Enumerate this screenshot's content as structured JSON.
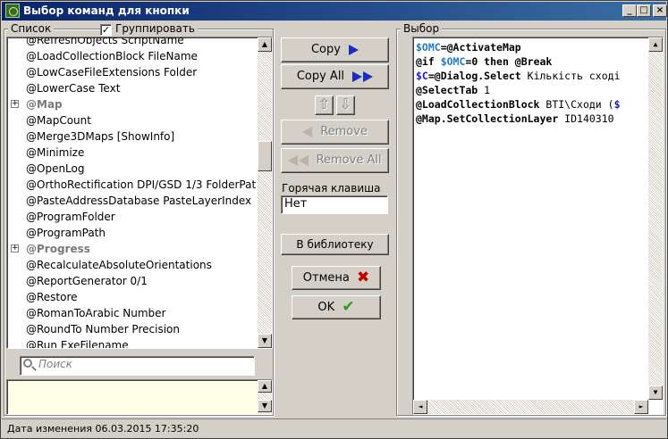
{
  "window": {
    "title": "Выбор команд для кнопки",
    "controls": {
      "minimize": "_",
      "maximize": "□",
      "close": "×"
    }
  },
  "list_panel": {
    "label": "Список",
    "group_checkbox_label": "Группировать",
    "group_checked": true,
    "items": [
      {
        "text": "@LoadCollectionBlock FileName",
        "type": "item"
      },
      {
        "text": "@LowCaseFileExtensions Folder",
        "type": "item"
      },
      {
        "text": "@LowerCase Text",
        "type": "item"
      },
      {
        "text": "@Map",
        "type": "group"
      },
      {
        "text": "@MapCount",
        "type": "item"
      },
      {
        "text": "@Merge3DMaps [ShowInfo]",
        "type": "item"
      },
      {
        "text": "@Minimize",
        "type": "item"
      },
      {
        "text": "@OpenLog",
        "type": "item"
      },
      {
        "text": "@OrthoRectification DPI/GSD 1/3 FolderPat",
        "type": "item"
      },
      {
        "text": "@PasteAddressDatabase PasteLayerIndex",
        "type": "item"
      },
      {
        "text": "@ProgramFolder",
        "type": "item"
      },
      {
        "text": "@ProgramPath",
        "type": "item"
      },
      {
        "text": "@Progress",
        "type": "group"
      },
      {
        "text": "@RecalculateAbsoluteOrientations",
        "type": "item"
      },
      {
        "text": "@ReportGenerator 0/1",
        "type": "item"
      },
      {
        "text": "@Restore",
        "type": "item"
      },
      {
        "text": "@RomanToArabic Number",
        "type": "item"
      },
      {
        "text": "@RoundTo Number Precision",
        "type": "item"
      },
      {
        "text": "@Run ExeFilename",
        "type": "item"
      }
    ],
    "partial_top_item": "@RefreshObjects ScriptName",
    "search_placeholder": "Поиск"
  },
  "middle": {
    "copy_label": "Copy",
    "copy_all_label": "Copy All",
    "remove_label": "Remove",
    "remove_all_label": "Remove All",
    "hotkey_label": "Горячая клавиша",
    "hotkey_value": "Нет",
    "library_label": "В библиотеку",
    "cancel_label": "Отмена",
    "ok_label": "OK",
    "up_arrow": "⇧",
    "down_arrow": "⇩"
  },
  "selection_panel": {
    "label": "Выбор",
    "lines": [
      [
        {
          "t": "$OMC",
          "c": "var"
        },
        {
          "t": "=@ActivateMap",
          "c": "kw"
        }
      ],
      [
        {
          "t": "@if ",
          "c": "kw"
        },
        {
          "t": "$OMC",
          "c": "var"
        },
        {
          "t": "=0 then @Break",
          "c": "kw"
        }
      ],
      [
        {
          "t": "$C",
          "c": "bl"
        },
        {
          "t": "=@Dialog.Select",
          "c": "kw"
        },
        {
          "t": " Кількість сході",
          "c": "txt"
        }
      ],
      [
        {
          "t": "@SelectTab",
          "c": "kw"
        },
        {
          "t": " 1",
          "c": "txt"
        }
      ],
      [
        {
          "t": "@LoadCollectionBlock",
          "c": "kw"
        },
        {
          "t": " BTI\\Сходи (",
          "c": "txt"
        },
        {
          "t": "$",
          "c": "bl"
        }
      ],
      [
        {
          "t": "@Map.SetCollectionLayer",
          "c": "kw"
        },
        {
          "t": " ID140310",
          "c": "txt"
        }
      ]
    ]
  },
  "status": {
    "text": "Дата изменения 06.03.2015 17:35:20"
  },
  "colors": {
    "title_bar": "#0a246a",
    "variable": "#1e7cc4",
    "blue_var": "#1a1acc",
    "hint_area": "#ffffe8"
  }
}
